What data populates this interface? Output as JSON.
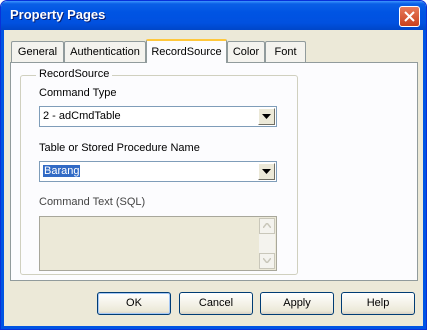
{
  "window": {
    "title": "Property Pages"
  },
  "tabs": [
    {
      "label": "General",
      "active": false
    },
    {
      "label": "Authentication",
      "active": false
    },
    {
      "label": "RecordSource",
      "active": true
    },
    {
      "label": "Color",
      "active": false
    },
    {
      "label": "Font",
      "active": false
    }
  ],
  "record_source": {
    "group_title": "RecordSource",
    "command_type": {
      "label": "Command Type",
      "value": "2 - adCmdTable"
    },
    "table_name": {
      "label": "Table or Stored Procedure Name",
      "value": "Barang"
    },
    "command_text": {
      "label": "Command Text (SQL)",
      "value": ""
    }
  },
  "buttons": {
    "ok": "OK",
    "cancel": "Cancel",
    "apply": "Apply",
    "help": "Help"
  },
  "colors": {
    "title_bar": "#0054e3",
    "face": "#ece9d8",
    "tab_highlight": "#ffc73c",
    "selection": "#316ac5"
  },
  "icons": [
    "close-icon",
    "chevron-down-icon",
    "scroll-up-icon",
    "scroll-down-icon"
  ]
}
